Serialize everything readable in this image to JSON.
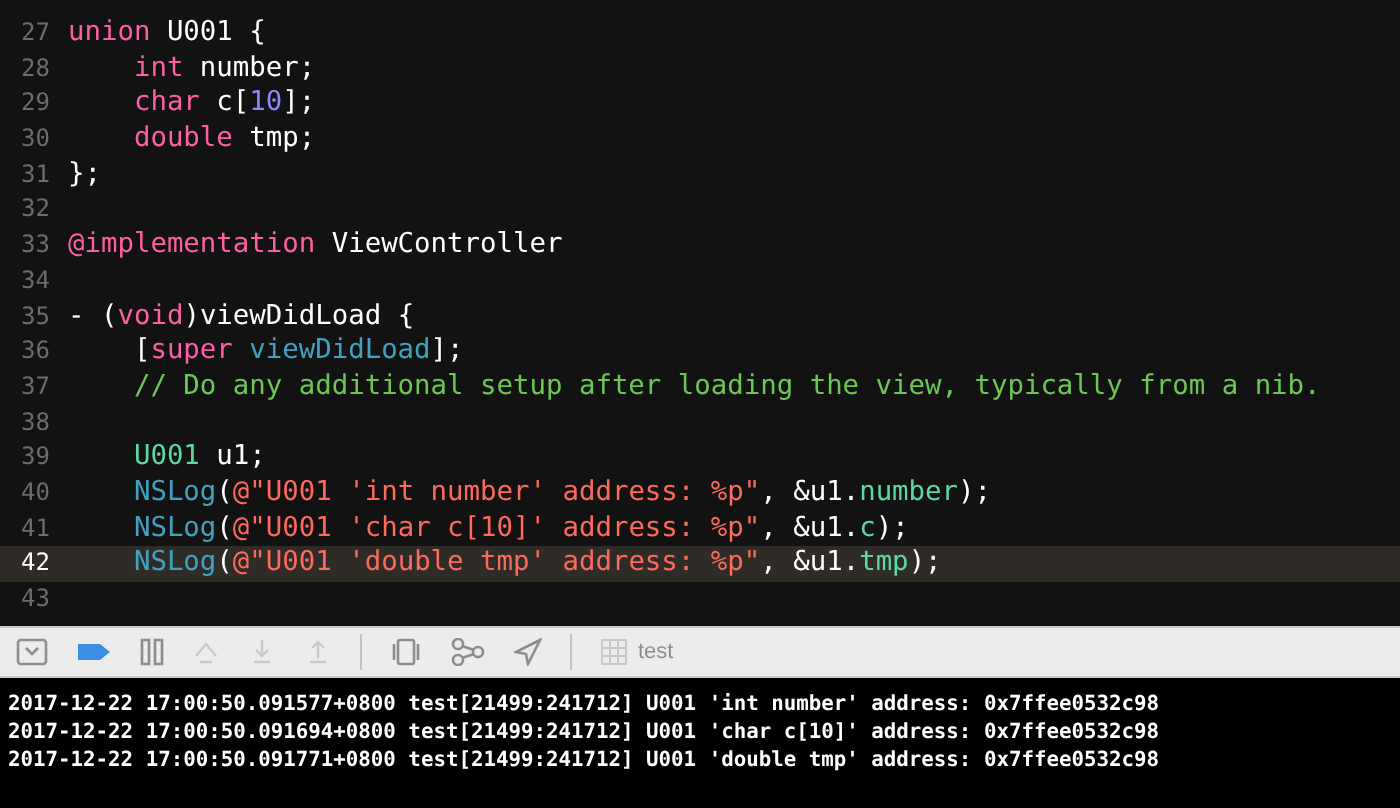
{
  "editor": {
    "lines": [
      {
        "number": "27",
        "current": false,
        "tokens": [
          {
            "kind": "keyword",
            "text": "union"
          },
          {
            "kind": "plain",
            "text": " U001 {"
          }
        ]
      },
      {
        "number": "28",
        "current": false,
        "tokens": [
          {
            "kind": "keyword",
            "text": "    int"
          },
          {
            "kind": "plain",
            "text": " number;"
          }
        ]
      },
      {
        "number": "29",
        "current": false,
        "tokens": [
          {
            "kind": "keyword",
            "text": "    char"
          },
          {
            "kind": "plain",
            "text": " c["
          },
          {
            "kind": "number",
            "text": "10"
          },
          {
            "kind": "plain",
            "text": "];"
          }
        ]
      },
      {
        "number": "30",
        "current": false,
        "tokens": [
          {
            "kind": "keyword",
            "text": "    double"
          },
          {
            "kind": "plain",
            "text": " tmp;"
          }
        ]
      },
      {
        "number": "31",
        "current": false,
        "tokens": [
          {
            "kind": "plain",
            "text": "};"
          }
        ]
      },
      {
        "number": "32",
        "current": false
      },
      {
        "number": "33",
        "current": false,
        "tokens": [
          {
            "kind": "keyword",
            "text": "@implementation"
          },
          {
            "kind": "plain",
            "text": " ViewController"
          }
        ]
      },
      {
        "number": "34",
        "current": false
      },
      {
        "number": "35",
        "current": false,
        "tokens": [
          {
            "kind": "plain",
            "text": "- ("
          },
          {
            "kind": "keyword",
            "text": "void"
          },
          {
            "kind": "plain",
            "text": ")viewDidLoad {"
          }
        ]
      },
      {
        "number": "36",
        "current": false,
        "tokens": [
          {
            "kind": "plain",
            "text": "    ["
          },
          {
            "kind": "keyword",
            "text": "super"
          },
          {
            "kind": "func",
            "text": " viewDidLoad"
          },
          {
            "kind": "plain",
            "text": "];"
          }
        ]
      },
      {
        "number": "37",
        "current": false,
        "tokens": [
          {
            "kind": "comment",
            "text": "    // Do any additional setup after loading the view, typically from a nib."
          }
        ]
      },
      {
        "number": "38",
        "current": false
      },
      {
        "number": "39",
        "current": false,
        "tokens": [
          {
            "kind": "type",
            "text": "    U001"
          },
          {
            "kind": "plain",
            "text": " u1;"
          }
        ]
      },
      {
        "number": "40",
        "current": false,
        "tokens": [
          {
            "kind": "func",
            "text": "    NSLog"
          },
          {
            "kind": "plain",
            "text": "("
          },
          {
            "kind": "string",
            "text": "@\"U001 'int number' address: %p\""
          },
          {
            "kind": "plain",
            "text": ", &u1."
          },
          {
            "kind": "type",
            "text": "number"
          },
          {
            "kind": "plain",
            "text": ");"
          }
        ]
      },
      {
        "number": "41",
        "current": false,
        "tokens": [
          {
            "kind": "func",
            "text": "    NSLog"
          },
          {
            "kind": "plain",
            "text": "("
          },
          {
            "kind": "string",
            "text": "@\"U001 'char c[10]' address: %p\""
          },
          {
            "kind": "plain",
            "text": ", &u1."
          },
          {
            "kind": "type",
            "text": "c"
          },
          {
            "kind": "plain",
            "text": ");"
          }
        ]
      },
      {
        "number": "42",
        "current": true,
        "tokens": [
          {
            "kind": "func",
            "text": "    NSLog"
          },
          {
            "kind": "plain",
            "text": "("
          },
          {
            "kind": "string",
            "text": "@\"U001 'double tmp' address: %p\""
          },
          {
            "kind": "plain",
            "text": ", &u1."
          },
          {
            "kind": "type",
            "text": "tmp"
          },
          {
            "kind": "plain",
            "text": ");"
          }
        ]
      },
      {
        "number": "43",
        "current": false
      }
    ]
  },
  "debug_bar": {
    "breakpoints_active": true,
    "target": "test"
  },
  "console": {
    "lines": [
      "2017-12-22 17:00:50.091577+0800 test[21499:241712] U001 'int number' address: 0x7ffee0532c98",
      "2017-12-22 17:00:50.091694+0800 test[21499:241712] U001 'char c[10]' address: 0x7ffee0532c98",
      "2017-12-22 17:00:50.091771+0800 test[21499:241712] U001 'double tmp' address: 0x7ffee0532c98"
    ]
  }
}
